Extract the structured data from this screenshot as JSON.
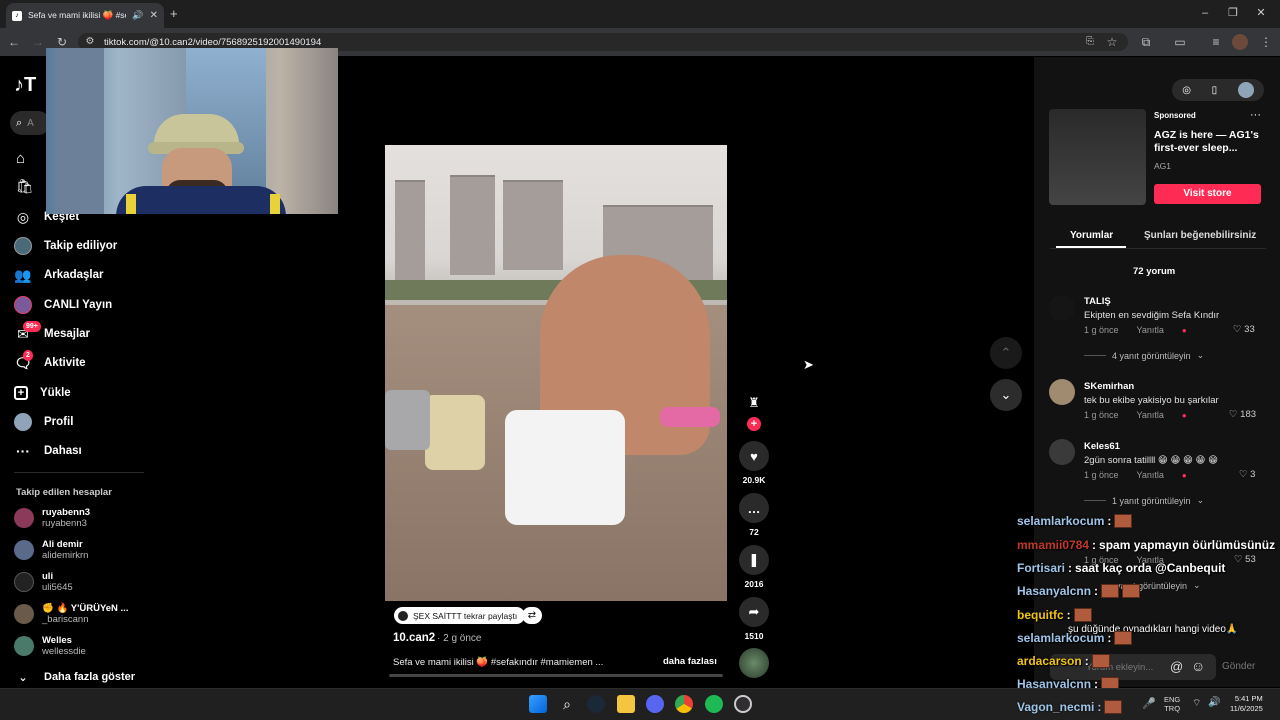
{
  "browser": {
    "tab_title": "Sefa ve mami ikilisi 🍑 #sefa",
    "url": "tiktok.com/@10.can2/video/7568925192001490194"
  },
  "sidebar": {
    "search_placeholder": "A",
    "items": [
      {
        "label": "Keşfet"
      },
      {
        "label": "Takip ediliyor"
      },
      {
        "label": "Arkadaşlar"
      },
      {
        "label": "CANLI Yayın"
      },
      {
        "label": "Mesajlar",
        "badge": "99+"
      },
      {
        "label": "Aktivite",
        "badge": "2"
      },
      {
        "label": "Yükle"
      },
      {
        "label": "Profil"
      },
      {
        "label": "Dahası"
      }
    ],
    "following_title": "Takip edilen hesaplar",
    "accounts": [
      {
        "name": "ruyabenn3",
        "handle": "ruyabenn3"
      },
      {
        "name": "Ali demir",
        "handle": "alidemirkrn"
      },
      {
        "name": "uli",
        "handle": "uli5645"
      },
      {
        "name": "✊ 🔥 Y'ÜRÜYeN ...",
        "handle": "_bariscann"
      },
      {
        "name": "Welles",
        "handle": "wellessdie"
      }
    ],
    "show_more": "Daha fazla göster"
  },
  "video": {
    "repost_label": "ŞEX SAİTTT tekrar paylaştı",
    "author": "10.can2",
    "time": "· 2 g önce",
    "caption": "Sefa ve mami ikilisi 🍑 #sefakındır #mamiemen ...",
    "more": "daha fazlası",
    "likes": "20.9K",
    "comments": "72",
    "saves": "2016",
    "shares": "1510"
  },
  "ad": {
    "sponsored": "Sponsored",
    "title": "AGZ is here — AG1's first-ever sleep...",
    "brand": "AG1",
    "cta": "Visit store"
  },
  "comments_panel": {
    "tab_comments": "Yorumlar",
    "tab_likes": "Şunları beğenebilirsiniz",
    "count": "72 yorum",
    "reply_label": "Yanıtla",
    "comments": [
      {
        "user": "TALIŞ",
        "text": "Ekipten en sevdiğim Sefa Kındır",
        "time": "1 g önce",
        "likes": "33",
        "replies": "4 yanıt görüntüleyin"
      },
      {
        "user": "SKemirhan",
        "text": "tek bu ekibe yakisiyo bu şarkılar",
        "time": "1 g önce",
        "likes": "183",
        "replies": ""
      },
      {
        "user": "Keles61",
        "text": "2gün sonra tatillll 😁 😁 😁 😁 😁",
        "time": "1 g önce",
        "likes": "3",
        "replies": "1 yanıt görüntüleyin"
      }
    ],
    "hidden_likes": "53",
    "hidden_replies": "yanıt görüntüleyin",
    "hidden_time": "1 g önce",
    "hidden_reply": "Yanıtla",
    "input_placeholder": "Yorum ekleyin...",
    "send": "Gönder"
  },
  "chat": [
    {
      "user": "selamlarkocum",
      "msg": "",
      "color": "#9fc5e8"
    },
    {
      "user": "mmamii0784",
      "msg": "spam yapmayın öürlümüsünüz",
      "color": "#c0392b"
    },
    {
      "user": "Fortisari",
      "msg": "saat kaç orda @Canbequit",
      "color": "#9fc5e8"
    },
    {
      "user": "Hasanyalcnn",
      "msg": "",
      "color": "#9fc5e8"
    },
    {
      "user": "bequitfc",
      "msg": "",
      "color": "#f1c40f"
    },
    {
      "user": "",
      "msg": "şu düğünde oynadıkları hangi video🙏",
      "color": "#ffffff"
    },
    {
      "user": "selamlarkocum",
      "msg": "",
      "color": "#9fc5e8"
    },
    {
      "user": "ardacarson",
      "msg": "",
      "color": "#f1c40f"
    },
    {
      "user": "Hasanyalcnn",
      "msg": "",
      "color": "#9fc5e8"
    },
    {
      "user": "Vagon_necmi",
      "msg": "",
      "color": "#9fc5e8"
    }
  ],
  "taskbar": {
    "lang1": "ENG",
    "lang2": "TRQ",
    "time": "5:41 PM",
    "date": "11/6/2025"
  }
}
